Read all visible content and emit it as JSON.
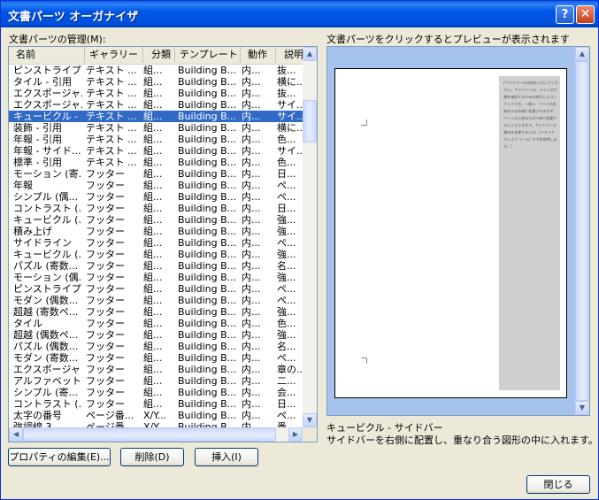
{
  "window": {
    "title": "文書パーツ オーガナイザ",
    "help_glyph": "?",
    "close_glyph": "✕"
  },
  "list_label": "文書パーツの管理(M):",
  "columns": [
    "名前",
    "ギャラリー",
    "分類",
    "テンプレート",
    "動作",
    "説明"
  ],
  "rows": [
    [
      "ピンストライプ ...",
      "テキスト ...",
      "組...",
      "Building B...",
      "内...",
      "抜..."
    ],
    [
      "タイル - 引用",
      "テキスト ...",
      "組...",
      "Building B...",
      "内...",
      "横に..."
    ],
    [
      "エクスポージャ...",
      "テキスト ...",
      "組...",
      "Building B...",
      "内...",
      "抜..."
    ],
    [
      "エクスポージャ...",
      "テキスト ...",
      "組...",
      "Building B...",
      "内...",
      "サイ..."
    ],
    [
      "キュービクル - ...",
      "テキスト ...",
      "組...",
      "Building B...",
      "内...",
      "サイ..."
    ],
    [
      "装飾 - 引用",
      "テキスト ...",
      "組...",
      "Building B...",
      "内...",
      "横に..."
    ],
    [
      "年報 - 引用",
      "テキスト ...",
      "組...",
      "Building B...",
      "内...",
      "色..."
    ],
    [
      "年報 - サイド...",
      "テキスト ...",
      "組...",
      "Building B...",
      "内...",
      "サイ..."
    ],
    [
      "標準 - 引用",
      "テキスト ...",
      "組...",
      "Building B...",
      "内...",
      "色..."
    ],
    [
      "モーション (寄...",
      "フッター",
      "組...",
      "Building B...",
      "内...",
      "日..."
    ],
    [
      "年報",
      "フッター",
      "組...",
      "Building B...",
      "内...",
      "ペ..."
    ],
    [
      "シンプル (偶...",
      "フッター",
      "組...",
      "Building B...",
      "内...",
      "ペ..."
    ],
    [
      "コントラスト (...",
      "フッター",
      "組...",
      "Building B...",
      "内...",
      "日..."
    ],
    [
      "キュービクル (...",
      "フッター",
      "組...",
      "Building B...",
      "内...",
      "強..."
    ],
    [
      "積み上げ",
      "フッター",
      "組...",
      "Building B...",
      "内...",
      "強..."
    ],
    [
      "サイドライン",
      "フッター",
      "組...",
      "Building B...",
      "内...",
      "ペ..."
    ],
    [
      "キュービクル (...",
      "フッター",
      "組...",
      "Building B...",
      "内...",
      "強..."
    ],
    [
      "パズル (寄数...",
      "フッター",
      "組...",
      "Building B...",
      "内...",
      "名..."
    ],
    [
      "モーション (偶...",
      "フッター",
      "組...",
      "Building B...",
      "内...",
      "強..."
    ],
    [
      "ピンストライプ",
      "フッター",
      "組...",
      "Building B...",
      "内...",
      "ペ..."
    ],
    [
      "モダン (偶数...",
      "フッター",
      "組...",
      "Building B...",
      "内...",
      "ペ..."
    ],
    [
      "超越 (寄数ペ...",
      "フッター",
      "組...",
      "Building B...",
      "内...",
      "強..."
    ],
    [
      "タイル",
      "フッター",
      "組...",
      "Building B...",
      "内...",
      "色..."
    ],
    [
      "超越 (偶数ペ...",
      "フッター",
      "組...",
      "Building B...",
      "内...",
      "強..."
    ],
    [
      "パズル (偶数...",
      "フッター",
      "組...",
      "Building B...",
      "内...",
      "名..."
    ],
    [
      "モダン (寄数...",
      "フッター",
      "組...",
      "Building B...",
      "内...",
      "ペ..."
    ],
    [
      "エクスポージャ",
      "フッター",
      "組...",
      "Building B...",
      "内...",
      "章の..."
    ],
    [
      "アルファベット",
      "フッター",
      "組...",
      "Building B...",
      "内...",
      "二..."
    ],
    [
      "シンプル (寄...",
      "フッター",
      "組...",
      "Building B...",
      "内...",
      "会..."
    ],
    [
      "コントラスト (...",
      "フッター",
      "組...",
      "Building B...",
      "内...",
      "日..."
    ],
    [
      "太字の番号",
      "ページ番...",
      "X/Y...",
      "Building B...",
      "内...",
      "ペ..."
    ],
    [
      "強調線 3",
      "ページ番...",
      "X/Y...",
      "Building B...",
      "内...",
      "番..."
    ]
  ],
  "selected_row": 4,
  "buttons": {
    "properties": "プロパティの編集(E)...",
    "delete": "削除(D)",
    "insert": "挿入(I)",
    "close": "閉じる"
  },
  "preview": {
    "label": "文書パーツをクリックするとプレビューが表示されます",
    "sidebar_sample": "[サイドバーの内容を入力してください。サイドバーは、メインの文書を補足するための独立したコンテンツです。一般に、ページの左側または右側に配置されますが、ページの上部または下部に配置することもできます。サイドバーの書式を変更するには、[テキスト ボックス ツール] タブを使用します。]",
    "item_name": "キュービクル - サイドバー",
    "item_desc": "サイドバーを右側に配置し、重なり合う図形の中に入れます。"
  },
  "colors": {
    "selection": "#316ac5",
    "title_bar": "#0055e5",
    "preview_bg": "#a5c3ed",
    "sidebar_fill": "#d0cfcf"
  },
  "icons": {
    "scroll_up": "▲",
    "scroll_down": "▼",
    "scroll_left": "◀",
    "scroll_right": "▶"
  }
}
